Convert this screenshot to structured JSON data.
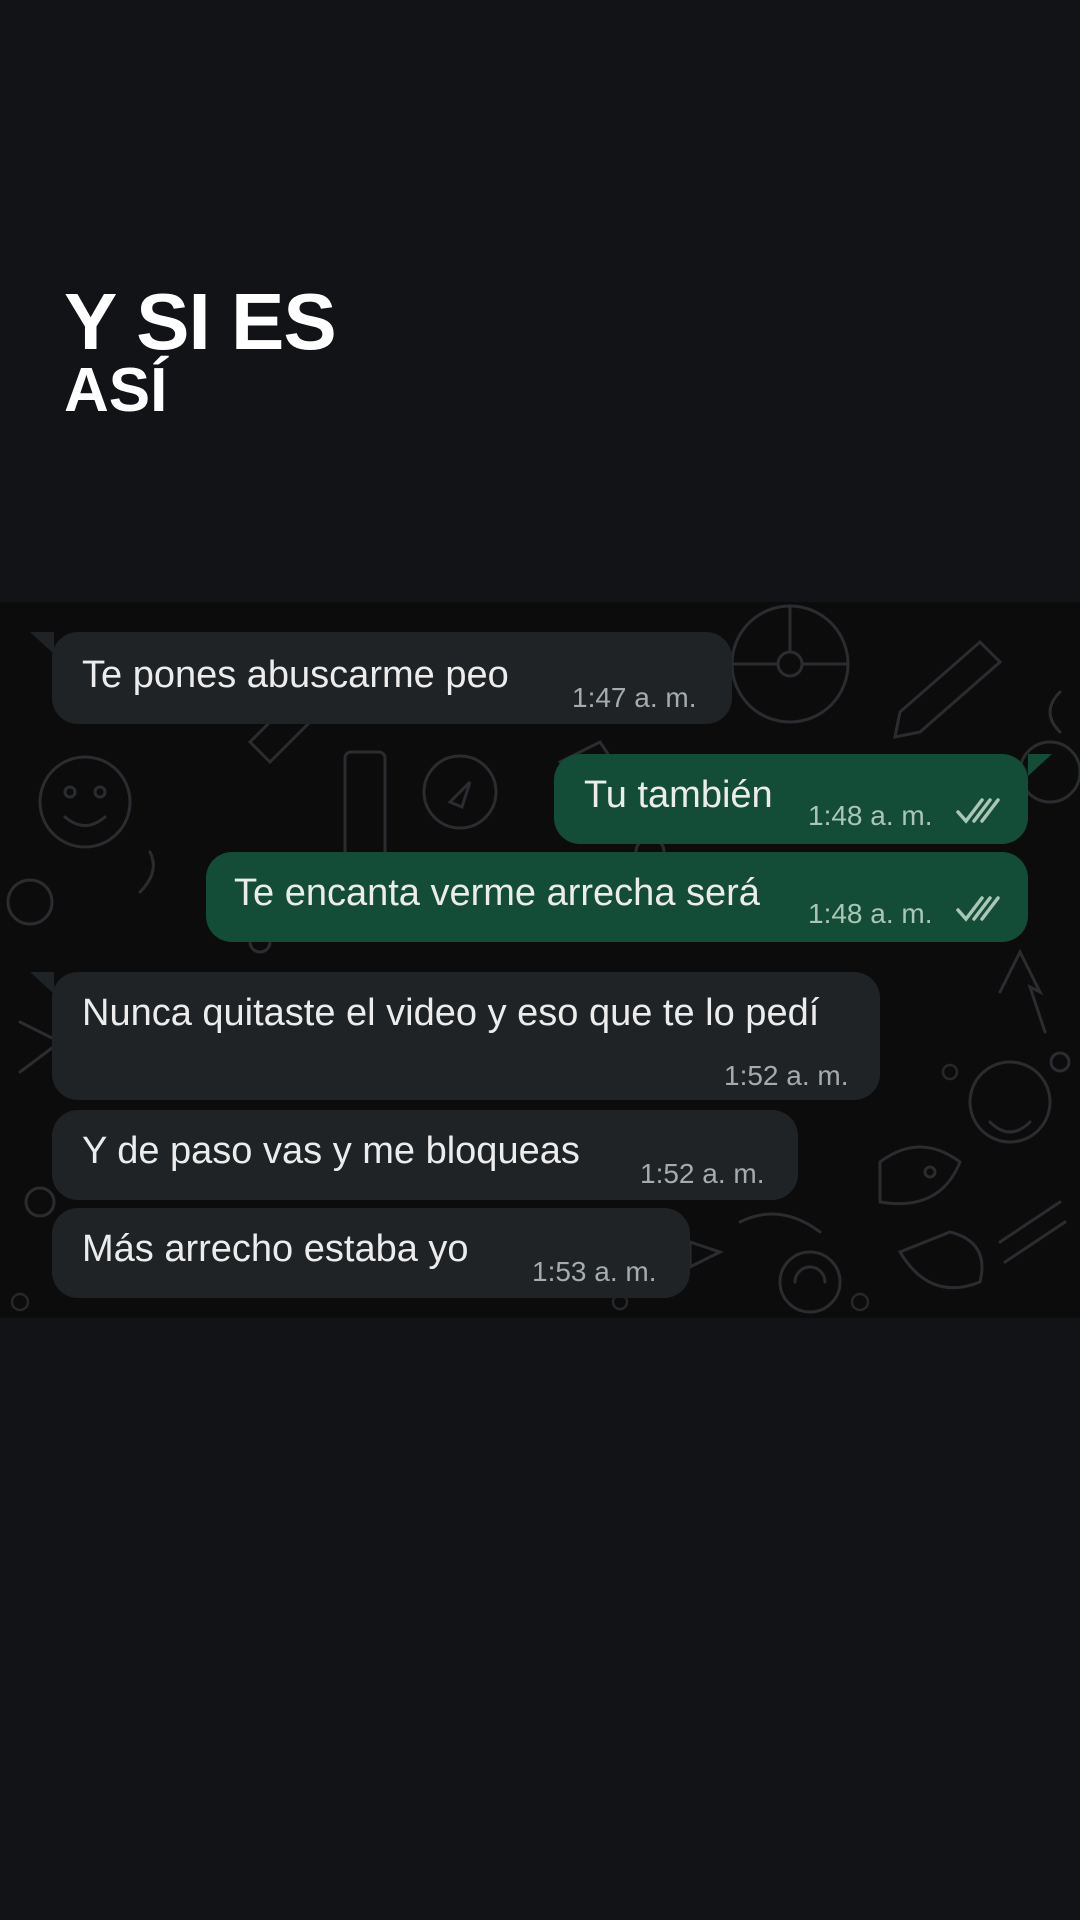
{
  "caption": {
    "line1": "Y SI ES",
    "line2": "ASÍ"
  },
  "colors": {
    "page_background": "#121316",
    "chat_background": "#0c0c0d",
    "incoming_bubble": "#1f2325",
    "outgoing_bubble": "#134d37",
    "text": "#ececec",
    "read_receipt": "#a9c6b8"
  },
  "messages": [
    {
      "direction": "incoming",
      "text": "Te pones abuscarme peo",
      "time": "1:47 a. m."
    },
    {
      "direction": "outgoing",
      "text": "Tu también",
      "time": "1:48 a. m.",
      "status_icon": "double-check-icon"
    },
    {
      "direction": "outgoing",
      "text": "Te encanta verme arrecha será",
      "time": "1:48 a. m.",
      "status_icon": "double-check-icon"
    },
    {
      "direction": "incoming",
      "text": "Nunca quitaste el video y eso que te lo pedí",
      "time": "1:52 a. m."
    },
    {
      "direction": "incoming",
      "text": "Y de paso vas y me bloqueas",
      "time": "1:52 a. m."
    },
    {
      "direction": "incoming",
      "text": "Más arrecho estaba yo",
      "time": "1:53 a. m."
    }
  ]
}
